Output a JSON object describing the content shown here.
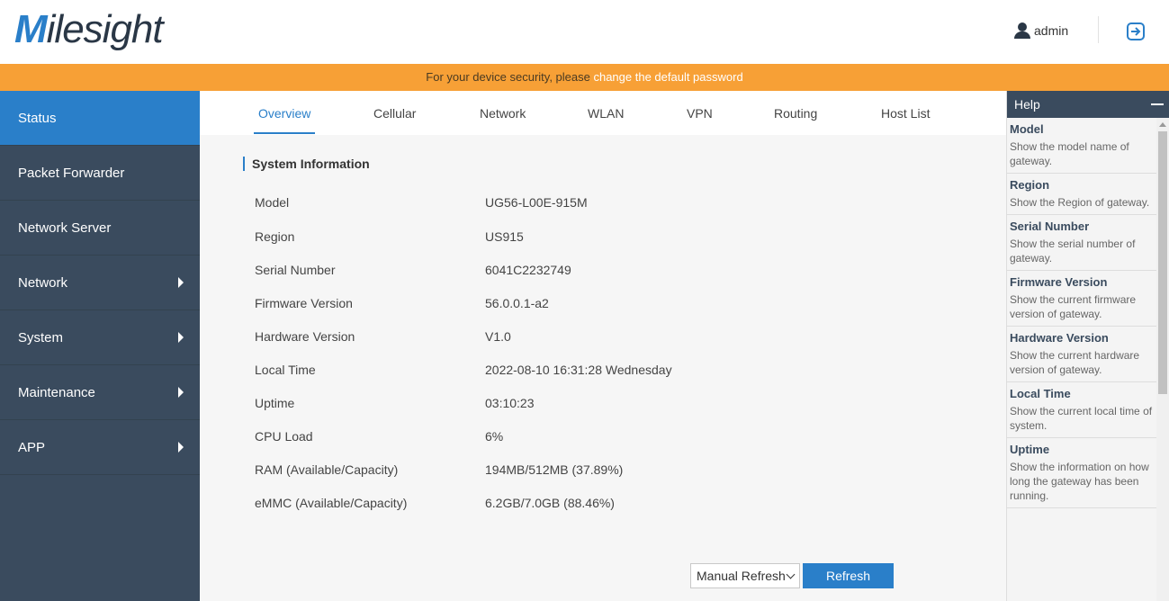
{
  "header": {
    "logo_m": "M",
    "logo_rest": "ilesight",
    "user": "admin",
    "user_icon": "user-icon",
    "logout_icon": "logout-icon"
  },
  "notice": {
    "text": "For your device security, please ",
    "link": "change the default password"
  },
  "sidebar": {
    "items": [
      {
        "label": "Status",
        "active": true
      },
      {
        "label": "Packet Forwarder"
      },
      {
        "label": "Network Server"
      },
      {
        "label": "Network",
        "has_submenu": true
      },
      {
        "label": "System",
        "has_submenu": true
      },
      {
        "label": "Maintenance",
        "has_submenu": true
      },
      {
        "label": "APP",
        "has_submenu": true
      }
    ]
  },
  "tabs": [
    "Overview",
    "Cellular",
    "Network",
    "WLAN",
    "VPN",
    "Routing",
    "Host List"
  ],
  "system_info": {
    "title": "System Information",
    "rows": [
      {
        "label": "Model",
        "value": "UG56-L00E-915M"
      },
      {
        "label": "Region",
        "value": "US915"
      },
      {
        "label": "Serial Number",
        "value": "6041C2232749"
      },
      {
        "label": "Firmware Version",
        "value": "56.0.0.1-a2"
      },
      {
        "label": "Hardware Version",
        "value": "V1.0"
      },
      {
        "label": "Local Time",
        "value": "2022-08-10 16:31:28 Wednesday"
      },
      {
        "label": "Uptime",
        "value": "03:10:23"
      },
      {
        "label": "CPU Load",
        "value": "6%"
      },
      {
        "label": "RAM (Available/Capacity)",
        "value": "194MB/512MB (37.89%)"
      },
      {
        "label": "eMMC (Available/Capacity)",
        "value": "6.2GB/7.0GB (88.46%)"
      }
    ]
  },
  "controls": {
    "refresh_mode": "Manual Refresh",
    "refresh_button": "Refresh"
  },
  "help": {
    "title": "Help",
    "items": [
      {
        "title": "Model",
        "desc": "Show the model name of gateway."
      },
      {
        "title": "Region",
        "desc": "Show the Region of gateway."
      },
      {
        "title": "Serial Number",
        "desc": "Show the serial number of gateway."
      },
      {
        "title": "Firmware Version",
        "desc": "Show the current firmware version of gateway."
      },
      {
        "title": "Hardware Version",
        "desc": "Show the current hardware version of gateway."
      },
      {
        "title": "Local Time",
        "desc": "Show the current local time of system."
      },
      {
        "title": "Uptime",
        "desc": "Show the information on how long the gateway has been running."
      }
    ]
  },
  "colors": {
    "accent": "#2a7fc9",
    "sidebar": "#3a4b5e",
    "notice": "#f7a036"
  }
}
